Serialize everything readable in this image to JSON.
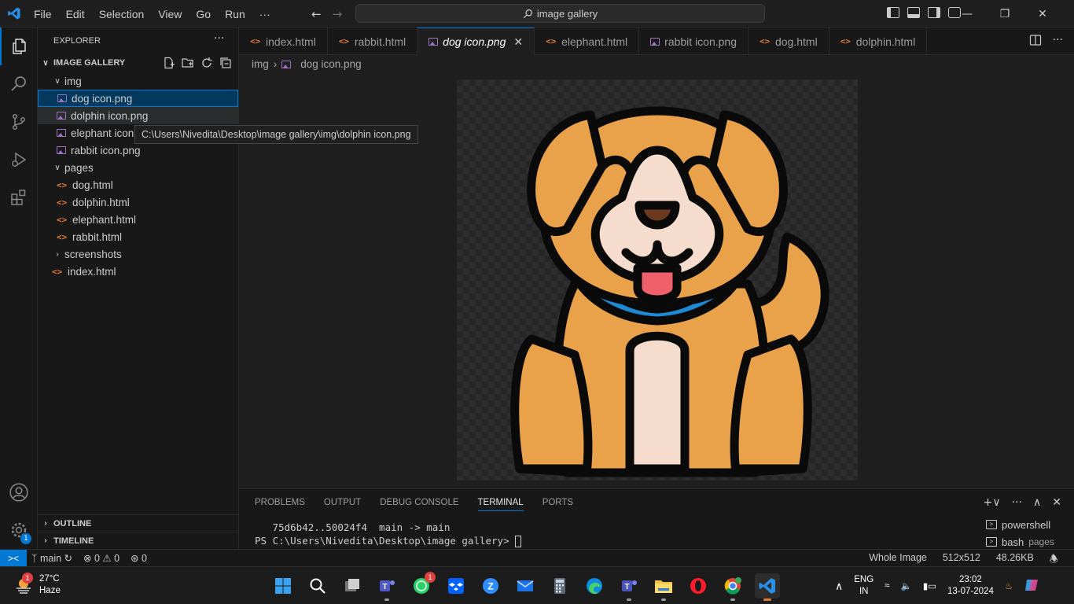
{
  "titlebar": {
    "menu": [
      "File",
      "Edit",
      "Selection",
      "View",
      "Go",
      "Run",
      "···"
    ],
    "search": "image gallery"
  },
  "explorer": {
    "title": "EXPLORER",
    "folder": "IMAGE GALLERY",
    "tree": [
      {
        "label": "img",
        "kind": "folder-open",
        "indent": 1
      },
      {
        "label": "dog icon.png",
        "kind": "image",
        "indent": 2,
        "state": "selected"
      },
      {
        "label": "dolphin icon.png",
        "kind": "image",
        "indent": 2,
        "state": "hover"
      },
      {
        "label": "elephant icon.png",
        "kind": "image",
        "indent": 2
      },
      {
        "label": "rabbit icon.png",
        "kind": "image",
        "indent": 2
      },
      {
        "label": "pages",
        "kind": "folder-open",
        "indent": 1
      },
      {
        "label": "dog.html",
        "kind": "html",
        "indent": 2
      },
      {
        "label": "dolphin.html",
        "kind": "html",
        "indent": 2
      },
      {
        "label": "elephant.html",
        "kind": "html",
        "indent": 2
      },
      {
        "label": "rabbit.html",
        "kind": "html",
        "indent": 2
      },
      {
        "label": "screenshots",
        "kind": "folder-closed",
        "indent": 1
      },
      {
        "label": "index.html",
        "kind": "html",
        "indent": 1
      }
    ],
    "tooltip": "C:\\Users\\Nivedita\\Desktop\\image gallery\\img\\dolphin icon.png",
    "outline": "OUTLINE",
    "timeline": "TIMELINE"
  },
  "tabs": [
    {
      "label": "index.html",
      "kind": "html"
    },
    {
      "label": "rabbit.html",
      "kind": "html"
    },
    {
      "label": "dog icon.png",
      "kind": "image",
      "active": true
    },
    {
      "label": "elephant.html",
      "kind": "html"
    },
    {
      "label": "rabbit icon.png",
      "kind": "image"
    },
    {
      "label": "dog.html",
      "kind": "html"
    },
    {
      "label": "dolphin.html",
      "kind": "html"
    }
  ],
  "breadcrumb": {
    "folder": "img",
    "file": "dog icon.png"
  },
  "panel": {
    "tabs": [
      "PROBLEMS",
      "OUTPUT",
      "DEBUG CONSOLE",
      "TERMINAL",
      "PORTS"
    ],
    "active_tab": "TERMINAL",
    "terminal_line1": "   75d6b42..50024f4  main -> main",
    "terminal_line2": "PS C:\\Users\\Nivedita\\Desktop\\image gallery> ",
    "terminals": [
      {
        "name": "powershell",
        "detail": ""
      },
      {
        "name": "bash",
        "detail": "pages"
      }
    ]
  },
  "statusbar": {
    "branch": "main",
    "errors": "0",
    "warnings": "0",
    "ports": "0",
    "view": "Whole Image",
    "dimensions": "512x512",
    "size": "48.26KB"
  },
  "taskbar": {
    "temp": "27°C",
    "weather": "Haze",
    "weather_badge": "1",
    "whatsapp_badge": "1",
    "lang1": "ENG",
    "lang2": "IN",
    "time": "23:02",
    "date": "13-07-2024"
  },
  "accounts_badge": "1",
  "colors": {
    "accent": "#0078d4",
    "html_icon": "#e37933",
    "image_icon": "#a074c4",
    "dog_fur": "#e9a24a",
    "dog_belly": "#f5dccd"
  }
}
